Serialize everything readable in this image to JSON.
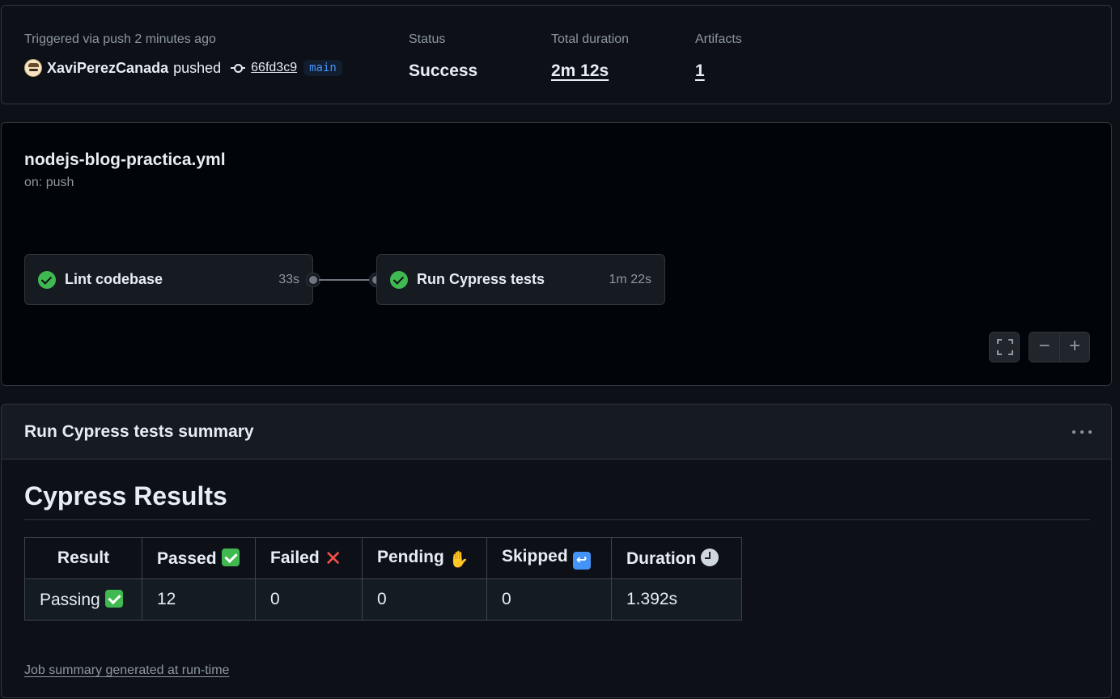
{
  "run": {
    "trigger_label": "Triggered via push 2 minutes ago",
    "actor": "XaviPerezCanada",
    "action": "pushed",
    "commit_sha": "66fd3c9",
    "branch": "main",
    "status_label": "Status",
    "status_value": "Success",
    "duration_label": "Total duration",
    "duration_value": "2m 12s",
    "artifacts_label": "Artifacts",
    "artifacts_value": "1"
  },
  "workflow": {
    "filename": "nodejs-blog-practica.yml",
    "trigger": "on: push",
    "jobs": [
      {
        "name": "Lint codebase",
        "duration": "33s",
        "status": "success"
      },
      {
        "name": "Run Cypress tests",
        "duration": "1m 22s",
        "status": "success"
      }
    ],
    "controls": {
      "zoom_out": "−",
      "zoom_in": "+"
    }
  },
  "job_summary": {
    "title": "Run Cypress tests summary",
    "heading": "Cypress Results",
    "table": {
      "headers": [
        "Result",
        "Passed",
        "Failed",
        "Pending",
        "Skipped",
        "Duration"
      ],
      "header_icons": [
        "",
        "check-mark-button-icon",
        "cross-mark-icon",
        "raised-hand-icon",
        "skip-arrow-icon",
        "clock-icon"
      ],
      "row": [
        "Passing",
        "12",
        "0",
        "0",
        "0",
        "1.392s"
      ]
    },
    "footnote": "Job summary generated at run-time"
  },
  "colors": {
    "background": "#0d1117",
    "graph_background": "#010409",
    "border": "#30363d",
    "success": "#3fb950",
    "link_blue": "#4493f8",
    "muted_text": "#8d96a0"
  }
}
